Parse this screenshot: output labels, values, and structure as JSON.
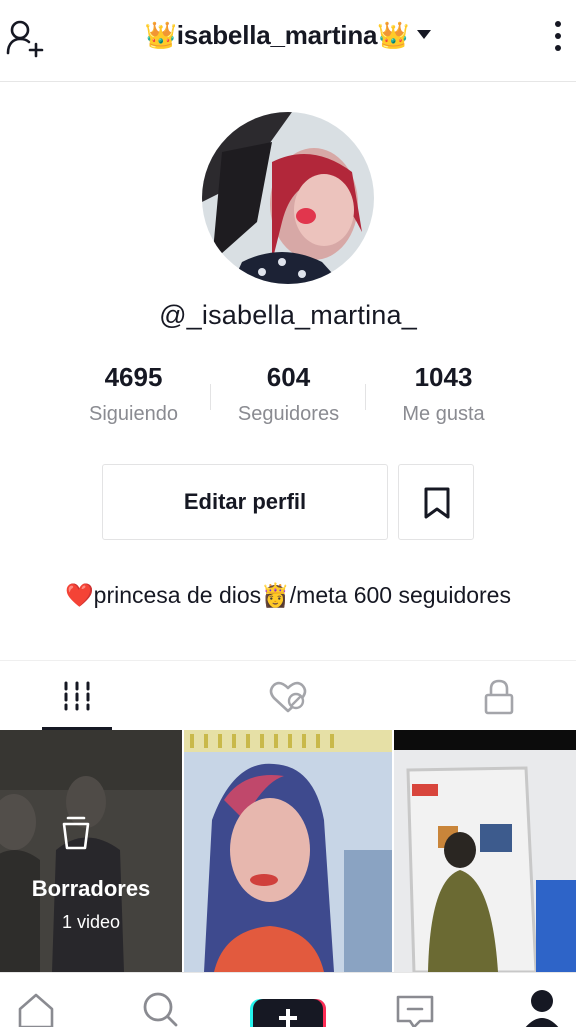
{
  "header": {
    "username": "👑isabella_martina👑",
    "icons": {
      "left": "add-user-icon",
      "right": "more-vertical-icon",
      "dropdown": "caret-down-icon"
    }
  },
  "profile": {
    "handle": "@_isabella_martina_",
    "avatar_icon": "profile-photo"
  },
  "stats": [
    {
      "value": "4695",
      "label": "Siguiendo"
    },
    {
      "value": "604",
      "label": "Seguidores"
    },
    {
      "value": "1043",
      "label": "Me gusta"
    }
  ],
  "actions": {
    "edit_label": "Editar perfil",
    "bookmark_icon": "bookmark-icon"
  },
  "bio": "❤️princesa de dios👸/meta 600 seguidores",
  "tabs": [
    {
      "icon": "grid-icon",
      "selected": true
    },
    {
      "icon": "liked-hidden-icon",
      "selected": false
    },
    {
      "icon": "lock-icon",
      "selected": false
    }
  ],
  "grid": {
    "drafts": {
      "label": "Borradores",
      "count": "1 video",
      "icon": "drafts-icon"
    }
  },
  "bottom_nav": [
    {
      "icon": "home-icon"
    },
    {
      "icon": "search-icon"
    },
    {
      "icon": "create-plus-icon"
    },
    {
      "icon": "inbox-icon"
    },
    {
      "icon": "profile-icon"
    }
  ],
  "colors": {
    "text": "#161823",
    "muted": "#8a8b91",
    "border": "#e3e3e4",
    "accent_red": "#fe2c55",
    "accent_cyan": "#25f4ee"
  }
}
